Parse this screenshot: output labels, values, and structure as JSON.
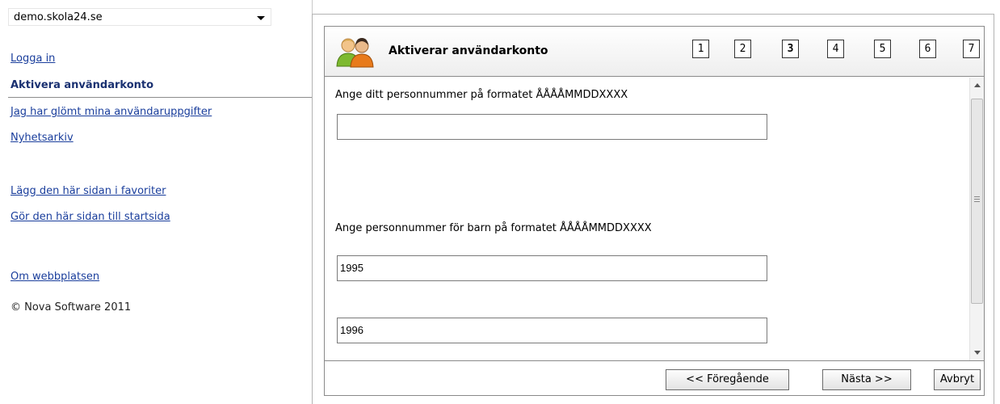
{
  "site_select": {
    "value": "demo.skola24.se"
  },
  "nav": {
    "login": "Logga in",
    "activate": "Aktivera användarkonto",
    "forgot": "Jag har glömt mina användaruppgifter",
    "news": "Nyhetsarkiv",
    "favorites": "Lägg den här sidan i favoriter",
    "startpage": "Gör den här sidan till startsida",
    "about": "Om webbplatsen",
    "copyright": "© Nova Software 2011"
  },
  "dialog": {
    "title": "Aktiverar användarkonto",
    "steps": [
      "1",
      "2",
      "3",
      "4",
      "5",
      "6",
      "7"
    ],
    "current_step": "3",
    "personnummer_label": "Ange ditt personnummer på formatet ÅÅÅÅMMDDXXXX",
    "personnummer_value": "",
    "children_label": "Ange personnummer för barn på formatet ÅÅÅÅMMDDXXXX",
    "child_1_value": "1995",
    "child_2_value": "1996",
    "buttons": {
      "previous": "<< Föregående",
      "next": "Nästa >>",
      "cancel": "Avbryt"
    }
  },
  "colors": {
    "link": "#1a3e9c",
    "active_nav": "#1a3171",
    "icon_green": "#7db92f",
    "icon_orange": "#e87a1b"
  }
}
